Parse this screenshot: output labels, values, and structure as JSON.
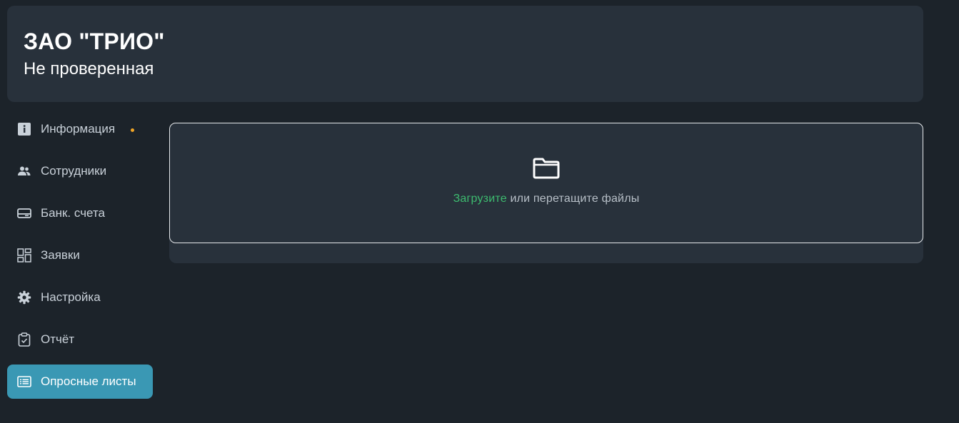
{
  "header": {
    "company_name": "ЗАО \"ТРИО\"",
    "status": "Не проверенная"
  },
  "sidebar": {
    "items": [
      {
        "label": "Информация",
        "icon": "info-icon",
        "has_dot": true,
        "active": false
      },
      {
        "label": "Сотрудники",
        "icon": "people-icon",
        "active": false
      },
      {
        "label": "Банк. счета",
        "icon": "wallet-icon",
        "active": false
      },
      {
        "label": "Заявки",
        "icon": "dashboard-icon",
        "active": false
      },
      {
        "label": "Настройка",
        "icon": "gear-icon",
        "active": false
      },
      {
        "label": "Отчёт",
        "icon": "clipboard-check-icon",
        "active": false
      },
      {
        "label": "Опросные листы",
        "icon": "list-icon",
        "active": true
      }
    ],
    "dot_color": "#f0a526",
    "active_color": "#3a98b4"
  },
  "dropzone": {
    "icon": "folder-icon",
    "upload_link": "Загрузите",
    "rest_text": "или перетащите файлы",
    "link_color": "#3dbb6f"
  }
}
